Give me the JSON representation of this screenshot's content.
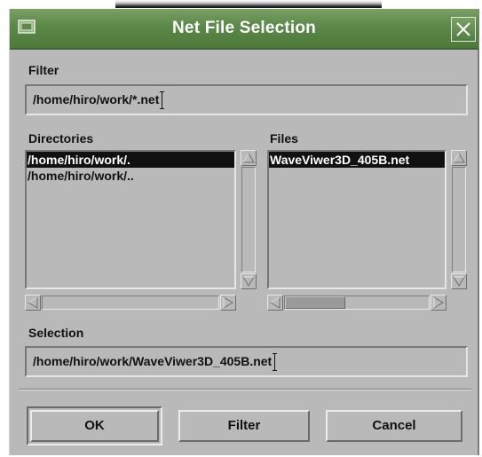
{
  "window": {
    "title": "Net File Selection"
  },
  "icons": {
    "menu": "window-menu-icon",
    "close": "close-icon",
    "scroll_up": "arrow-up-icon",
    "scroll_down": "arrow-down-icon",
    "scroll_left": "arrow-left-icon",
    "scroll_right": "arrow-right-icon"
  },
  "filter": {
    "label": "Filter",
    "value": "/home/hiro/work/*.net"
  },
  "directories": {
    "label": "Directories",
    "items": [
      "/home/hiro/work/.",
      "/home/hiro/work/.."
    ],
    "selected_index": 0
  },
  "files": {
    "label": "Files",
    "items": [
      "WaveViwer3D_405B.net"
    ],
    "selected_index": 0
  },
  "selection": {
    "label": "Selection",
    "value": "/home/hiro/work/WaveViwer3D_405B.net"
  },
  "buttons": {
    "ok": "OK",
    "filter": "Filter",
    "cancel": "Cancel"
  },
  "colors": {
    "titlebar": "#5d8a4a",
    "dialog_bg": "#b9b9b9",
    "selected_bg": "#111111",
    "selected_fg": "#ffffff"
  }
}
